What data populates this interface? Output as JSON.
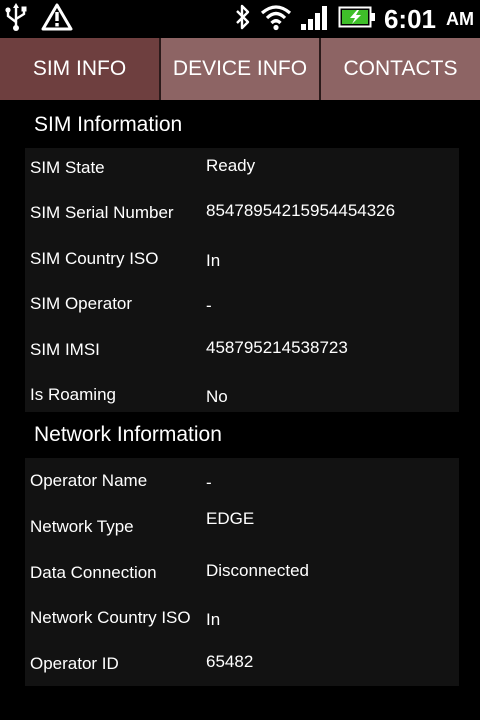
{
  "status_bar": {
    "left_icons": [
      "usb-icon",
      "warning-icon"
    ],
    "right_icons": [
      "bluetooth-icon",
      "wifi-icon",
      "signal-icon",
      "battery-charging-icon"
    ],
    "time": "6:01",
    "ampm": "AM"
  },
  "tabs": [
    {
      "label": "SIM INFO",
      "selected": true
    },
    {
      "label": "DEVICE INFO",
      "selected": false
    },
    {
      "label": "CONTACTS",
      "selected": false
    }
  ],
  "sim_section": {
    "title": "SIM Information",
    "rows": [
      {
        "label": "SIM State",
        "value": "Ready"
      },
      {
        "label": "SIM Serial Number",
        "value": "85478954215954454326"
      },
      {
        "label": "SIM Country ISO",
        "value": "In"
      },
      {
        "label": "SIM Operator",
        "value": "-"
      },
      {
        "label": "SIM IMSI",
        "value": "458795214538723"
      },
      {
        "label": "Is Roaming",
        "value": "No"
      }
    ]
  },
  "network_section": {
    "title": "Network Information",
    "rows": [
      {
        "label": "Operator Name",
        "value": "-"
      },
      {
        "label": "Network Type",
        "value": "EDGE"
      },
      {
        "label": "Data Connection",
        "value": "Disconnected"
      },
      {
        "label": "Network Country ISO",
        "value": "In"
      },
      {
        "label": "Operator ID",
        "value": "65482"
      }
    ]
  },
  "colors": {
    "tab_selected": "#6e3f3f",
    "tab_normal": "#8d6464",
    "panel": "#121212",
    "battery_fill": "#3fbf2a"
  }
}
